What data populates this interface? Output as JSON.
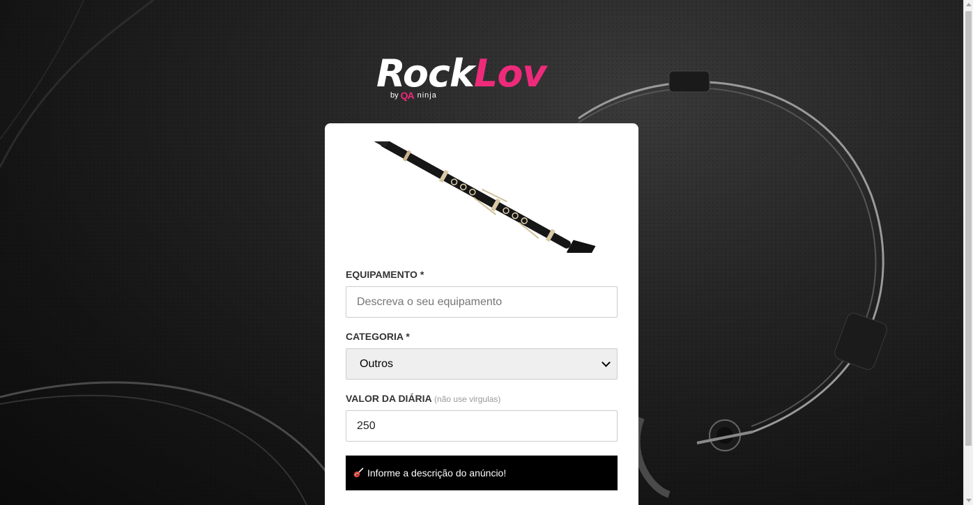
{
  "brand": {
    "name_part1": "Rock",
    "name_part2": "Lov",
    "by": "by",
    "qa": "QA",
    "ninja": "ninja"
  },
  "form": {
    "equipment_label": "EQUIPAMENTO *",
    "equipment_placeholder": "Descreva o seu equipamento",
    "equipment_value": "",
    "category_label": "CATEGORIA *",
    "category_selected": "Outros",
    "price_label": "VALOR DA DIÁRIA",
    "price_hint": "(não use virgulas)",
    "price_value": "250"
  },
  "alert": {
    "message": "Informe a descrição do anúncio!",
    "icon": "guitar-icon"
  },
  "colors": {
    "brand_pink": "#ee2a7b",
    "alert_bg": "#000000"
  }
}
